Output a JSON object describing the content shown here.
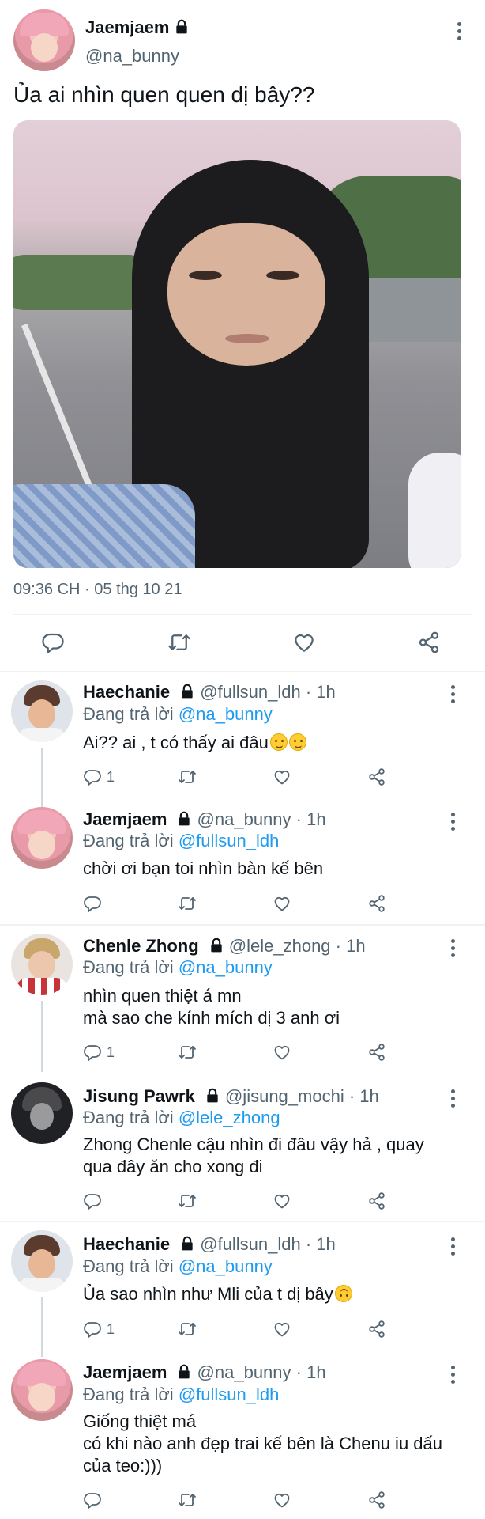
{
  "main_tweet": {
    "author_name": "Jaemjaem",
    "handle": "@na_bunny",
    "text": "Ủa ai nhìn quen quen dị bây??",
    "timestamp": "09:36 CH · 05 thg 10 21",
    "avatar": "pink-haired-profile-photo"
  },
  "replies": [
    {
      "author_name": "Haechanie",
      "handle": "@fullsun_ldh",
      "time": "· 1h",
      "replying_prefix": "Đang trả lời",
      "replying_to": "@na_bunny",
      "text": "Ai?? ai , t có thấy ai đâu",
      "reply_count": "1"
    },
    {
      "author_name": "Jaemjaem",
      "handle": "@na_bunny",
      "time": "· 1h",
      "replying_prefix": "Đang trả lời",
      "replying_to": "@fullsun_ldh",
      "text": "chời ơi bạn toi nhìn bàn kế bên",
      "reply_count": ""
    },
    {
      "author_name": "Chenle Zhong",
      "handle": "@lele_zhong",
      "time": "· 1h",
      "replying_prefix": "Đang trả lời",
      "replying_to": "@na_bunny",
      "text_line1": "nhìn quen thiệt á mn",
      "text_line2": "mà sao che kính mích dị 3 anh ơi",
      "reply_count": "1"
    },
    {
      "author_name": "Jisung Pawrk",
      "handle": "@jisung_mochi",
      "time": "· 1h",
      "replying_prefix": "Đang trả lời",
      "replying_to": "@lele_zhong",
      "text_line1": "Zhong Chenle cậu nhìn đi đâu vậy hả , quay",
      "text_line2": "qua đây ăn cho xong đi",
      "reply_count": ""
    },
    {
      "author_name": "Haechanie",
      "handle": "@fullsun_ldh",
      "time": "· 1h",
      "replying_prefix": "Đang trả lời",
      "replying_to": "@na_bunny",
      "text": "Ủa sao nhìn như Mli của t dị bây",
      "reply_count": "1"
    },
    {
      "author_name": "Jaemjaem",
      "handle": "@na_bunny",
      "time": "· 1h",
      "replying_prefix": "Đang trả lời",
      "replying_to": "@fullsun_ldh",
      "text_line1": "Giống thiệt má",
      "text_line2": "có khi nào anh đẹp trai kế bên là Chenu iu dấu",
      "text_line3": "của teo:)))",
      "reply_count": ""
    }
  ],
  "colors": {
    "text": "#0f1419",
    "secondary": "#536471",
    "link": "#1d9bf0",
    "divider": "#eff3f4"
  },
  "icons": [
    "lock-icon",
    "more-icon",
    "reply-icon",
    "retweet-icon",
    "like-icon",
    "share-icon",
    "emoji-icon"
  ]
}
